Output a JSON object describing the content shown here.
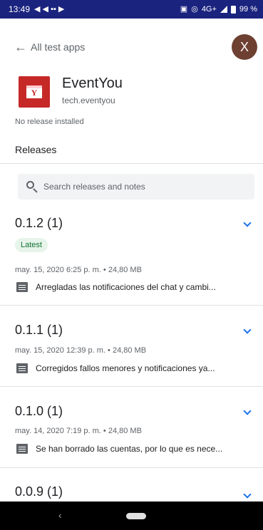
{
  "status_bar": {
    "time": "13:49",
    "network": "4G+",
    "battery": "99 %"
  },
  "header": {
    "back_label": "All test apps",
    "avatar_initial": "X"
  },
  "app": {
    "name": "EventYou",
    "package": "tech.eventyou",
    "icon_letter": "Y",
    "install_status": "No release installed"
  },
  "releases": {
    "title": "Releases",
    "search_placeholder": "Search releases and notes",
    "items": [
      {
        "version": "0.1.2 (1)",
        "badge": "Latest",
        "meta": "may. 15, 2020 6:25 p. m. • 24,80 MB",
        "notes": "Arregladas las notificaciones del chat y cambi..."
      },
      {
        "version": "0.1.1 (1)",
        "meta": "may. 15, 2020 12:39 p. m. • 24,80 MB",
        "notes": "Corregidos fallos menores y notificaciones ya..."
      },
      {
        "version": "0.1.0 (1)",
        "meta": "may. 14, 2020 7:19 p. m. • 24,80 MB",
        "notes": "Se han borrado las cuentas, por lo que es nece..."
      },
      {
        "version": "0.0.9 (1)"
      }
    ]
  },
  "nav_bar": {
    "back_glyph": "‹"
  },
  "colors": {
    "status_bar": "#1a237e",
    "app_icon": "#c62828",
    "avatar": "#6d4032",
    "accent": "#1a73e8",
    "badge_bg": "#e6f4ea",
    "badge_text": "#137333"
  }
}
